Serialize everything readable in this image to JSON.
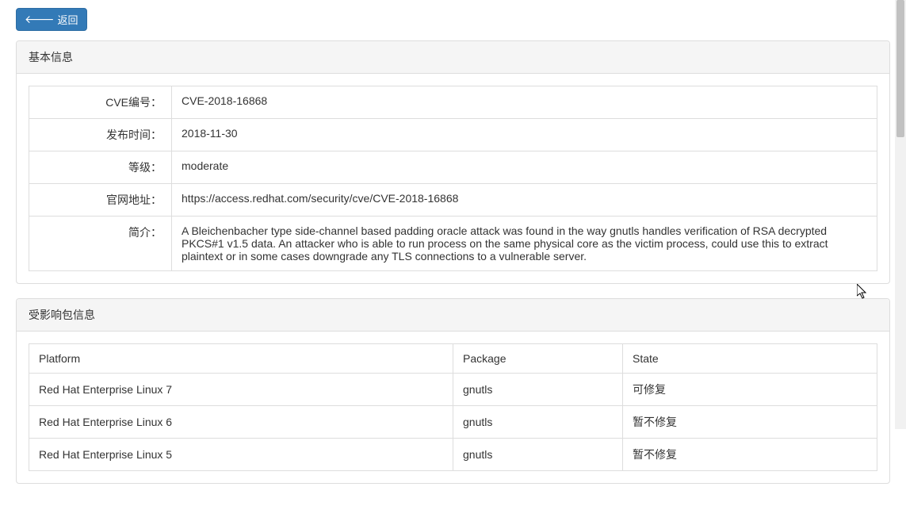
{
  "back_button_label": "返回",
  "basic_info": {
    "panel_title": "基本信息",
    "rows": [
      {
        "label": "CVE编号：",
        "value": "CVE-2018-16868"
      },
      {
        "label": "发布时间：",
        "value": "2018-11-30"
      },
      {
        "label": "等级：",
        "value": "moderate"
      },
      {
        "label": "官网地址：",
        "value": "https://access.redhat.com/security/cve/CVE-2018-16868"
      },
      {
        "label": "简介：",
        "value": "A Bleichenbacher type side-channel based padding oracle attack was found in the way gnutls handles verification of RSA decrypted PKCS#1 v1.5 data. An attacker who is able to run process on the same physical core as the victim process, could use this to extract plaintext or in some cases downgrade any TLS connections to a vulnerable server."
      }
    ]
  },
  "affected": {
    "panel_title": "受影响包信息",
    "headers": {
      "platform": "Platform",
      "package": "Package",
      "state": "State"
    },
    "rows": [
      {
        "platform": "Red Hat Enterprise Linux 7",
        "package": "gnutls",
        "state": "可修复"
      },
      {
        "platform": "Red Hat Enterprise Linux 6",
        "package": "gnutls",
        "state": "暂不修复"
      },
      {
        "platform": "Red Hat Enterprise Linux 5",
        "package": "gnutls",
        "state": "暂不修复"
      }
    ]
  }
}
